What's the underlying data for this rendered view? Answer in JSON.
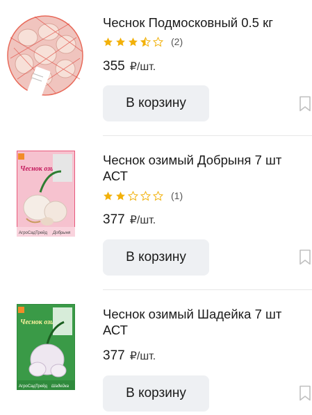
{
  "products": [
    {
      "title": "Чеснок Подмосковный 0.5 кг",
      "rating_stars": 3.5,
      "rating_count": "(2)",
      "price": "355",
      "price_unit": "₽/шт.",
      "cart_label": "В корзину"
    },
    {
      "title": "Чеснок озимый Добрыня 7 шт АСТ",
      "rating_stars": 2,
      "rating_count": "(1)",
      "price": "377",
      "price_unit": "₽/шт.",
      "cart_label": "В корзину",
      "pack": {
        "brand": "АгроСадТрейд",
        "name": "Чеснок озимый",
        "variety": "Добрыня",
        "color": "#e8577a"
      }
    },
    {
      "title": "Чеснок озимый Шадейка 7 шт АСТ",
      "price": "377",
      "price_unit": "₽/шт.",
      "cart_label": "В корзину",
      "pack": {
        "brand": "АгроСадТрейд",
        "name": "Чеснок озимый",
        "variety": "Шадейка",
        "color": "#2f8a3c"
      }
    }
  ],
  "colors": {
    "star": "#f2b10a",
    "star_empty": "#c9c9c9",
    "button_bg": "#eef0f3",
    "bookmark": "#bfbfbf"
  },
  "icons": {
    "star": "star-icon",
    "bookmark": "bookmark-icon"
  }
}
